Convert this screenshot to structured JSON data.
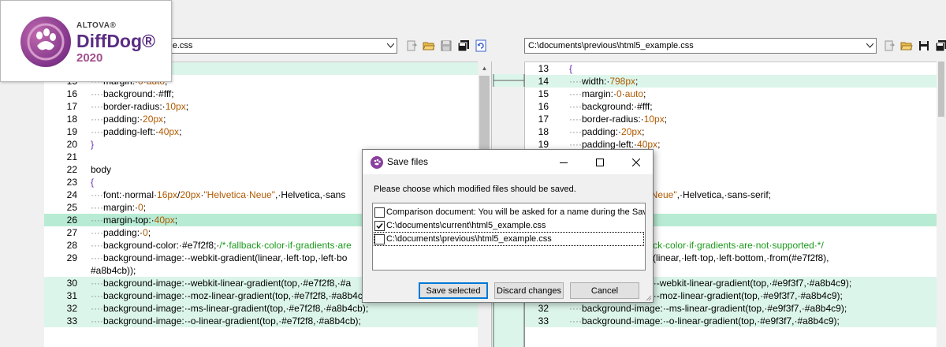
{
  "logo": {
    "brand_small": "ALTOVA®",
    "brand_name": "DiffDog®",
    "year": "2020"
  },
  "left_header": {
    "path_visible": "mple.css"
  },
  "right_header": {
    "path": "C:\\documents\\previous\\html5_example.css"
  },
  "left_lines": [
    {
      "n": "",
      "hl": "hl",
      "segs": [
        [
          "dots",
          "····"
        ],
        [
          "plain",
          "width:·"
        ],
        [
          "val",
          "840px"
        ],
        [
          "plain",
          ";"
        ]
      ]
    },
    {
      "n": "15",
      "hl": "",
      "segs": [
        [
          "dots",
          "····"
        ],
        [
          "plain",
          "margin:·"
        ],
        [
          "val",
          "0"
        ],
        [
          "plain",
          "·"
        ],
        [
          "val",
          "auto"
        ],
        [
          "plain",
          ";"
        ]
      ]
    },
    {
      "n": "16",
      "hl": "",
      "segs": [
        [
          "dots",
          "····"
        ],
        [
          "plain",
          "background:·#fff;"
        ]
      ]
    },
    {
      "n": "17",
      "hl": "",
      "segs": [
        [
          "dots",
          "····"
        ],
        [
          "plain",
          "border-radius:·"
        ],
        [
          "val",
          "10px"
        ],
        [
          "plain",
          ";"
        ]
      ]
    },
    {
      "n": "18",
      "hl": "",
      "segs": [
        [
          "dots",
          "····"
        ],
        [
          "plain",
          "padding:·"
        ],
        [
          "val",
          "20px"
        ],
        [
          "plain",
          ";"
        ]
      ]
    },
    {
      "n": "19",
      "hl": "",
      "segs": [
        [
          "dots",
          "····"
        ],
        [
          "plain",
          "padding-left:·"
        ],
        [
          "val",
          "40px"
        ],
        [
          "plain",
          ";"
        ]
      ]
    },
    {
      "n": "20",
      "hl": "",
      "segs": [
        [
          "brace",
          "}"
        ]
      ]
    },
    {
      "n": "21",
      "hl": "",
      "segs": []
    },
    {
      "n": "22",
      "hl": "",
      "segs": [
        [
          "plain",
          "body"
        ]
      ]
    },
    {
      "n": "23",
      "hl": "",
      "segs": [
        [
          "brace",
          "{"
        ]
      ]
    },
    {
      "n": "24",
      "hl": "",
      "segs": [
        [
          "dots",
          "····"
        ],
        [
          "plain",
          "font:·normal·"
        ],
        [
          "val",
          "16px"
        ],
        [
          "plain",
          "/"
        ],
        [
          "val",
          "20px"
        ],
        [
          "plain",
          "·"
        ],
        [
          "str",
          "\"Helvetica·Neue\""
        ],
        [
          "plain",
          ",·Helvetica,·sans"
        ]
      ]
    },
    {
      "n": "25",
      "hl": "",
      "segs": [
        [
          "dots",
          "····"
        ],
        [
          "plain",
          "margin:·"
        ],
        [
          "val",
          "0"
        ],
        [
          "plain",
          ";"
        ]
      ]
    },
    {
      "n": "26",
      "hl": "hl2",
      "segs": [
        [
          "dots",
          "····"
        ],
        [
          "plain",
          "margin-top:·"
        ],
        [
          "val",
          "40px"
        ],
        [
          "plain",
          ";"
        ]
      ]
    },
    {
      "n": "27",
      "hl": "",
      "segs": [
        [
          "dots",
          "····"
        ],
        [
          "plain",
          "padding:·"
        ],
        [
          "val",
          "0"
        ],
        [
          "plain",
          ";"
        ]
      ]
    },
    {
      "n": "28",
      "hl": "",
      "segs": [
        [
          "dots",
          "····"
        ],
        [
          "plain",
          "background-color:·#e7f2f8;·"
        ],
        [
          "com",
          "/*·fallback·color·if·gradients·are"
        ]
      ]
    },
    {
      "n": "29",
      "hl": "",
      "segs": [
        [
          "dots",
          "····"
        ],
        [
          "plain",
          "background-image:·-webkit-gradient(linear,·left·top,·left·bo"
        ]
      ]
    },
    {
      "n": "",
      "hl": "",
      "segs": [
        [
          "plain",
          "#a8b4cb));"
        ]
      ]
    },
    {
      "n": "30",
      "hl": "hl",
      "segs": [
        [
          "dots",
          "····"
        ],
        [
          "plain",
          "background-image:·-webkit-linear-gradient(top,·#e7f2f8,·#a"
        ]
      ]
    },
    {
      "n": "31",
      "hl": "hl",
      "segs": [
        [
          "dots",
          "····"
        ],
        [
          "plain",
          "background-image:·-moz-linear-gradient(top,·#e7f2f8,·#a8b4cb);"
        ]
      ]
    },
    {
      "n": "32",
      "hl": "hl",
      "segs": [
        [
          "dots",
          "····"
        ],
        [
          "plain",
          "background-image:·-ms-linear-gradient(top,·#e7f2f8,·#a8b4cb);"
        ]
      ]
    },
    {
      "n": "33",
      "hl": "hl",
      "segs": [
        [
          "dots",
          "····"
        ],
        [
          "plain",
          "background-image:·-o-linear-gradient(top,·#e7f2f8,·#a8b4cb);"
        ]
      ]
    }
  ],
  "right_lines": [
    {
      "n": "13",
      "hl": "",
      "segs": [
        [
          "brace",
          "{"
        ]
      ]
    },
    {
      "n": "14",
      "hl": "hl",
      "segs": [
        [
          "dots",
          "····"
        ],
        [
          "plain",
          "width:·"
        ],
        [
          "val",
          "798px"
        ],
        [
          "plain",
          ";"
        ]
      ]
    },
    {
      "n": "15",
      "hl": "",
      "segs": [
        [
          "dots",
          "····"
        ],
        [
          "plain",
          "margin:·"
        ],
        [
          "val",
          "0"
        ],
        [
          "plain",
          "·"
        ],
        [
          "val",
          "auto"
        ],
        [
          "plain",
          ";"
        ]
      ]
    },
    {
      "n": "16",
      "hl": "",
      "segs": [
        [
          "dots",
          "····"
        ],
        [
          "plain",
          "background:·#fff;"
        ]
      ]
    },
    {
      "n": "17",
      "hl": "",
      "segs": [
        [
          "dots",
          "····"
        ],
        [
          "plain",
          "border-radius:·"
        ],
        [
          "val",
          "10px"
        ],
        [
          "plain",
          ";"
        ]
      ]
    },
    {
      "n": "18",
      "hl": "",
      "segs": [
        [
          "dots",
          "····"
        ],
        [
          "plain",
          "padding:·"
        ],
        [
          "val",
          "20px"
        ],
        [
          "plain",
          ";"
        ]
      ]
    },
    {
      "n": "19",
      "hl": "",
      "segs": [
        [
          "dots",
          "····"
        ],
        [
          "plain",
          "padding-left:·"
        ],
        [
          "val",
          "40px"
        ],
        [
          "plain",
          ";"
        ]
      ]
    },
    {
      "n": "",
      "hl": "",
      "segs": []
    },
    {
      "n": "",
      "hl": "",
      "segs": []
    },
    {
      "n": "",
      "hl": "",
      "segs": []
    },
    {
      "n": "",
      "hl": "",
      "segs": [
        [
          "val",
          "px"
        ],
        [
          "plain",
          "/"
        ],
        [
          "val",
          "20px"
        ],
        [
          "plain",
          "·"
        ],
        [
          "str",
          "\"Helvetica·Neue\""
        ],
        [
          "plain",
          ",·Helvetica,·sans-serif;"
        ]
      ]
    },
    {
      "n": "",
      "hl": "",
      "segs": []
    },
    {
      "n": "",
      "hl": "hl2",
      "segs": [
        [
          "plain",
          "x;"
        ]
      ]
    },
    {
      "n": "",
      "hl": "",
      "segs": []
    },
    {
      "n": "",
      "hl": "",
      "segs": [
        [
          "plain",
          "or:·#e9f3f7;·"
        ],
        [
          "com",
          "/*·fallback·color·if·gradients·are·not·supported·*/"
        ]
      ]
    },
    {
      "n": "",
      "hl": "",
      "segs": [
        [
          "plain",
          "ge:·-webkit-gradient(linear,·left·top,·left·bottom,·from(#e7f2f8),"
        ]
      ]
    },
    {
      "n": "",
      "hl": "",
      "segs": []
    },
    {
      "n": "",
      "hl": "hl",
      "segs": [
        [
          "plain",
          "·background-image:·-webkit-linear-gradient(top,·#e9f3f7,·#a8b4c9);"
        ]
      ]
    },
    {
      "n": "",
      "hl": "hl",
      "segs": [
        [
          "plain",
          "·background-image:·-moz-linear-gradient(top,·#e9f3f7,·#a8b4c9);"
        ]
      ]
    },
    {
      "n": "32",
      "hl": "hl",
      "segs": [
        [
          "dots",
          "····"
        ],
        [
          "plain",
          "background-image:·-ms-linear-gradient(top,·#e9f3f7,·#a8b4c9);"
        ]
      ]
    },
    {
      "n": "33",
      "hl": "hl",
      "segs": [
        [
          "dots",
          "····"
        ],
        [
          "plain",
          "background-image:·-o-linear-gradient(top,·#e9f3f7,·#a8b4c9);"
        ]
      ]
    }
  ],
  "dialog": {
    "title": "Save files",
    "prompt": "Please choose which modified files should be saved.",
    "files": [
      {
        "label": "Comparison document: You will be asked for a name during the Save",
        "checked": false
      },
      {
        "label": "C:\\documents\\current\\html5_example.css",
        "checked": true
      },
      {
        "label": "C:\\documents\\previous\\html5_example.css",
        "checked": false
      }
    ],
    "buttons": {
      "save_selected": "Save selected",
      "discard": "Discard changes",
      "cancel": "Cancel"
    }
  },
  "colors": {
    "diff_highlight": "#dcf5ea",
    "diff_current": "#b8ebd3",
    "value": "#b05a00",
    "comment": "#1a9a1a",
    "brace": "#6a2db8",
    "brand_purple": "#5b2d82"
  }
}
